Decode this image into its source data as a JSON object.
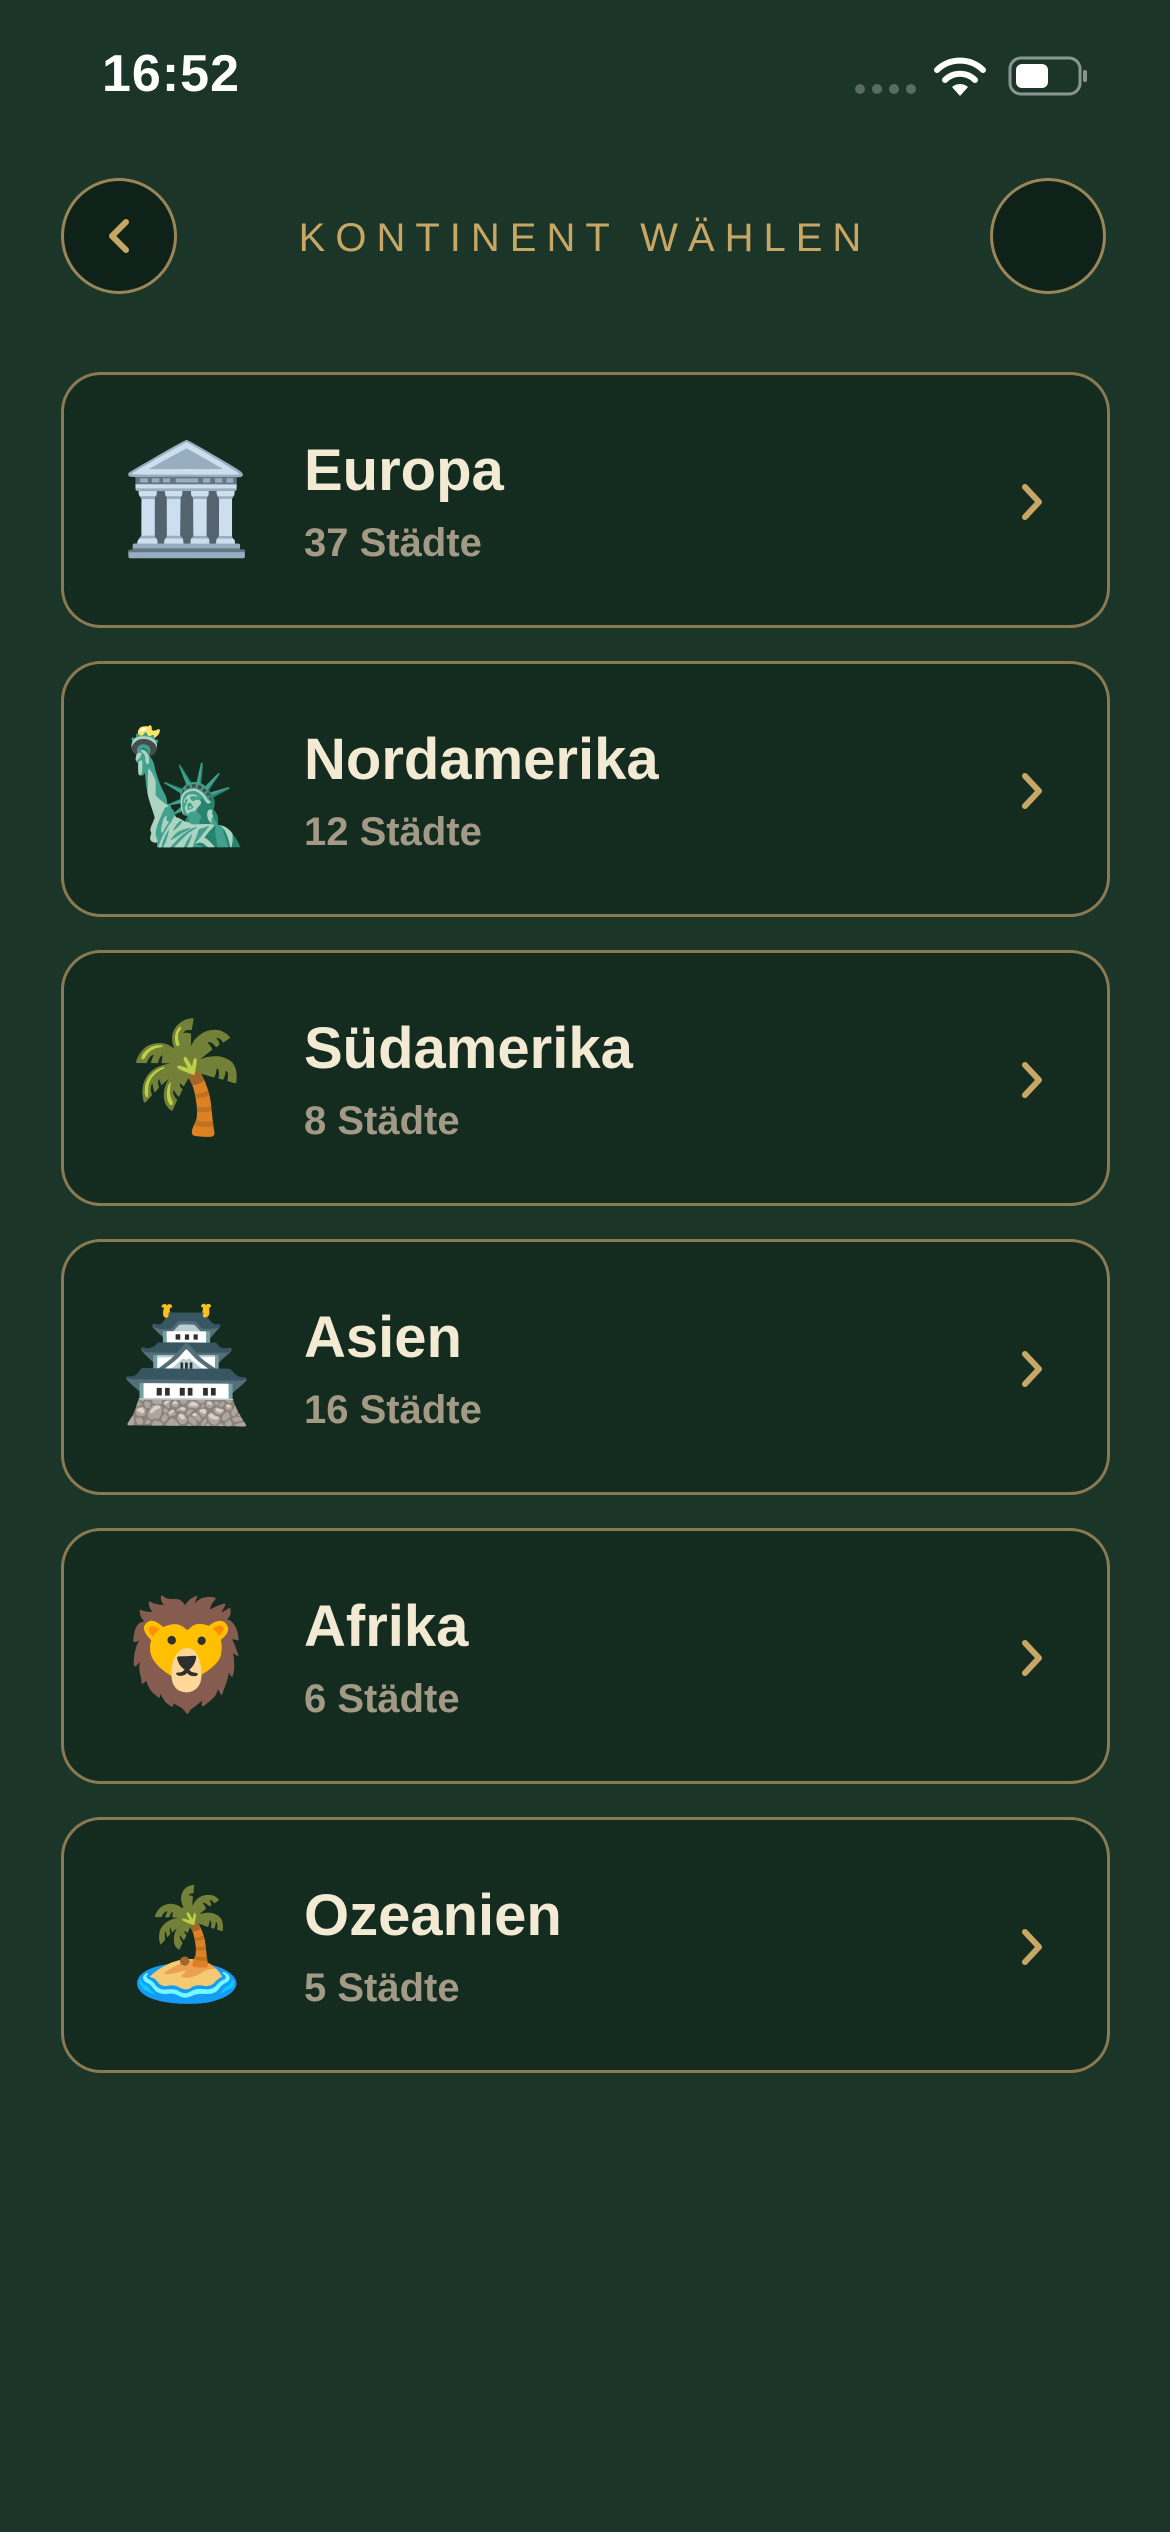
{
  "status_bar": {
    "time": "16:52",
    "icons": [
      "cellular-signal-icon",
      "wifi-icon",
      "battery-icon"
    ]
  },
  "header": {
    "title": "KONTINENT WÄHLEN",
    "back_icon": "chevron-left-icon"
  },
  "continents": [
    {
      "name": "Europa",
      "count": "37 Städte",
      "emoji": "🏛️"
    },
    {
      "name": "Nordamerika",
      "count": "12 Städte",
      "emoji": "🗽"
    },
    {
      "name": "Südamerika",
      "count": "8 Städte",
      "emoji": "🌴"
    },
    {
      "name": "Asien",
      "count": "16 Städte",
      "emoji": "🏯"
    },
    {
      "name": "Afrika",
      "count": "6 Städte",
      "emoji": "🦁"
    },
    {
      "name": "Ozeanien",
      "count": "5 Städte",
      "emoji": "🏝️"
    }
  ],
  "colors": {
    "background": "#1b3628",
    "card_background": "#142b20",
    "accent_gold": "#c8a765",
    "card_border": "#8a7a52",
    "primary_text": "#f3ead4",
    "secondary_text": "#a39a86"
  }
}
